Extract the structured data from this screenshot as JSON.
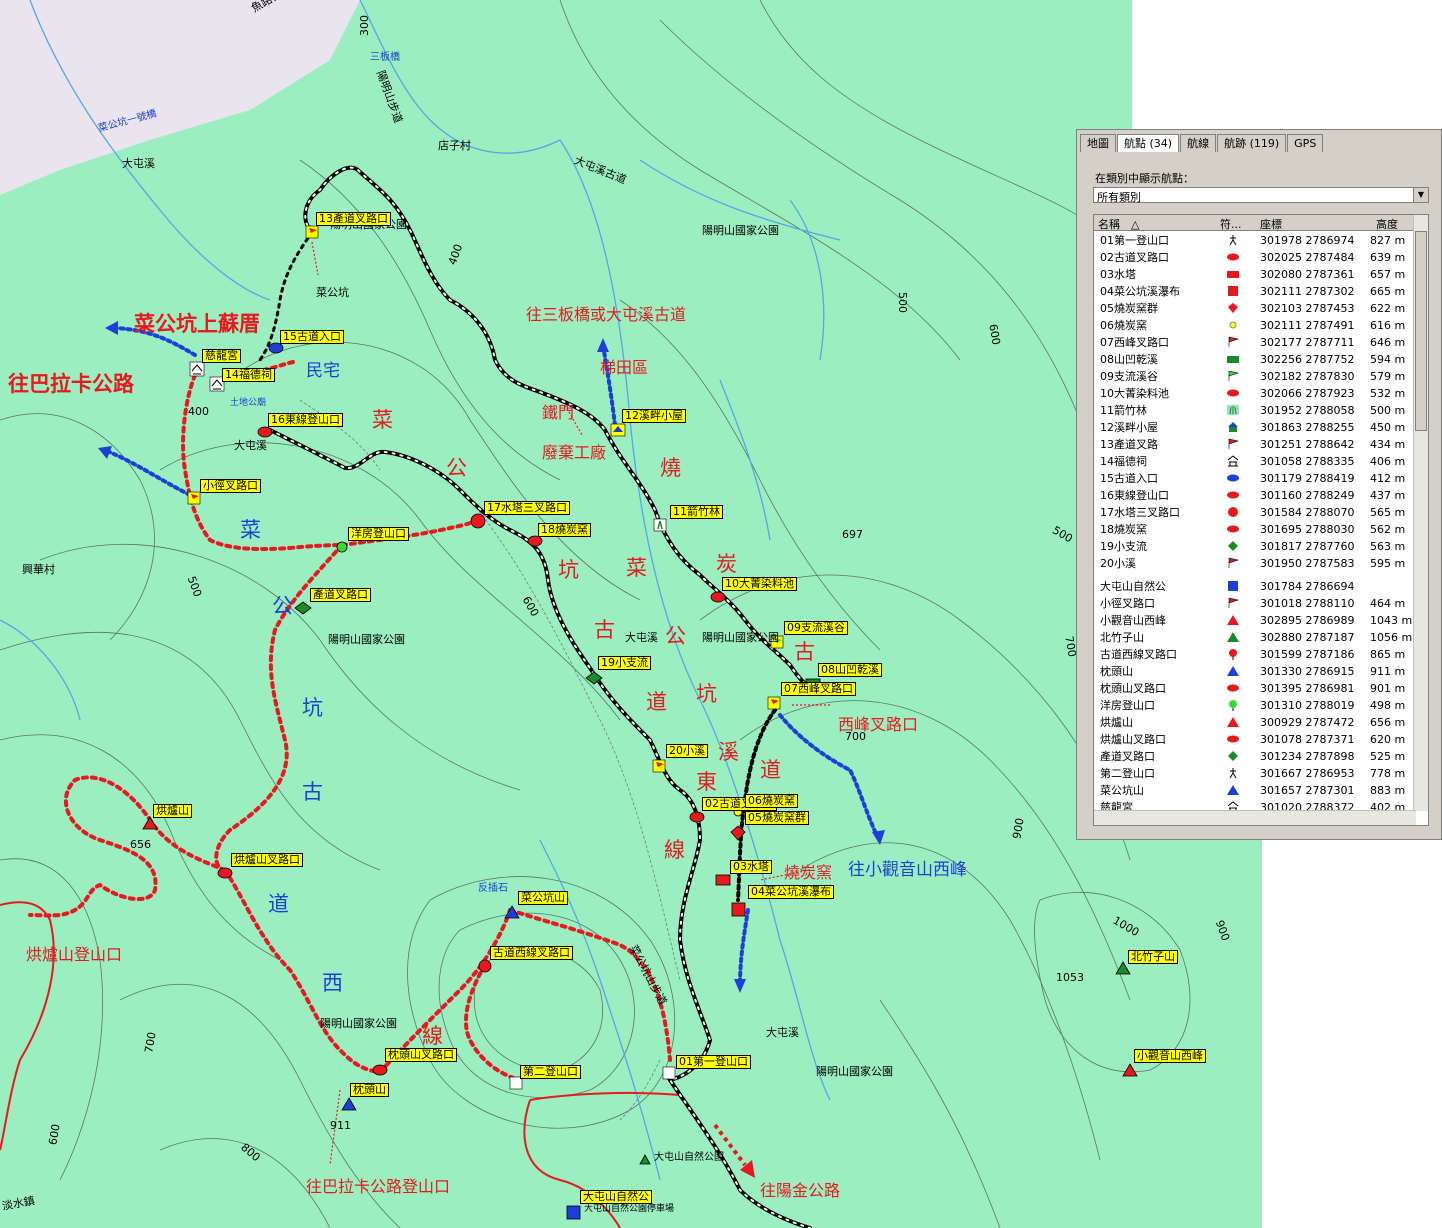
{
  "map": {
    "roads": [
      "魚路古道",
      "陽明山步道",
      "大屯溪古道",
      "菜公坑山步道",
      "菜公坑一號橋",
      "三板橋"
    ],
    "places": [
      "店子村",
      "大屯溪",
      "大屯溪",
      "大屯溪",
      "菜公坑",
      "土地公廟",
      "興華村",
      "陽明山國家公園",
      "陽明山國家公園",
      "陽明山國家公園",
      "陽明山國家公園",
      "陽明山國家公園",
      "陽明山國家公園",
      "反插石",
      "大屯山自然公園",
      "大屯山自然公園停車場",
      "淡水鎮"
    ],
    "contours": [
      "300",
      "400",
      "400",
      "500",
      "500",
      "500",
      "600",
      "600",
      "600",
      "700",
      "700",
      "700",
      "800",
      "900",
      "900",
      "1000",
      "697",
      "656",
      "911",
      "1053"
    ],
    "waypoints": [
      "13產道叉路口",
      "15古道入口",
      "慈龍宮",
      "14福德祠",
      "16東線登山口",
      "小徑叉路口",
      "洋房登山口",
      "產道叉路口",
      "17水塔三叉路口",
      "18燒炭窯",
      "12溪畔小屋",
      "11箭竹林",
      "10大菁染料池",
      "09支流溪谷",
      "08山凹乾溪",
      "07西峰叉路口",
      "19小支流",
      "20小溪",
      "02古道叉路口",
      "06燒炭窯",
      "05燒炭窯群",
      "03水塔",
      "04菜公坑溪瀑布",
      "烘爐山",
      "烘爐山叉路口",
      "菜公坑山",
      "古道西線叉路口",
      "枕頭山叉路口",
      "枕頭山",
      "第二登山口",
      "01第一登山口",
      "北竹子山",
      "小觀音山西峰",
      "大屯山自然公"
    ],
    "notes": {
      "caigong_sufu": "菜公坑上蘇厝",
      "to_balaka": "往巴拉卡公路",
      "residence": "民宅",
      "to_sanban": "往三板橋或大屯溪古道",
      "terrace": "梯田區",
      "iron_door": "鐵門",
      "factory": "廢棄工廠",
      "west_peak_fork": "西峰叉路口",
      "to_xiaoguanyin": "往小觀音山西峰",
      "charcoal_kiln": "燒炭窯",
      "honglu_trailhead": "烘爐山登山口",
      "to_balaka_trailhead": "往巴拉卡公路登山口",
      "to_yangjin": "往陽金公路",
      "west_trail": [
        "菜",
        "公",
        "坑",
        "古",
        "道",
        "西",
        "線"
      ],
      "east_trail": [
        "東",
        "溪",
        "道",
        "線"
      ],
      "kiln_trail": [
        "菜",
        "公",
        "坑",
        "古",
        "道"
      ],
      "shao_tan": [
        "燒",
        "炭",
        "古"
      ],
      "caigong_vertical": [
        "菜",
        "公",
        "坑"
      ]
    }
  },
  "panel": {
    "tabs": [
      "地圖",
      "航點 (34)",
      "航線",
      "航跡 (119)",
      "GPS"
    ],
    "active_tab": 1,
    "category_label": "在類別中顯示航點：",
    "category_value": "所有類別",
    "columns": [
      "名稱　△",
      "符...",
      "座標",
      "高度"
    ],
    "rows": [
      {
        "name": "01第一登山口",
        "icon": "hiker-icon",
        "coord": "301978 2786974",
        "alt": "827 m"
      },
      {
        "name": "02古道叉路口",
        "icon": "red-oval-icon",
        "coord": "302025 2787484",
        "alt": "639 m"
      },
      {
        "name": "03水塔",
        "icon": "red-rect-icon",
        "coord": "302080 2787361",
        "alt": "657 m"
      },
      {
        "name": "04菜公坑溪瀑布",
        "icon": "red-square-icon",
        "coord": "302111 2787302",
        "alt": "665 m"
      },
      {
        "name": "05燒炭窯群",
        "icon": "red-diamond-icon",
        "coord": "302103 2787453",
        "alt": "622 m"
      },
      {
        "name": "06燒炭窯",
        "icon": "yellow-dot-icon",
        "coord": "302111 2787491",
        "alt": "616 m"
      },
      {
        "name": "07西峰叉路口",
        "icon": "red-flag-icon",
        "coord": "302177 2787711",
        "alt": "646 m"
      },
      {
        "name": "08山凹乾溪",
        "icon": "green-rect-icon",
        "coord": "302256 2787752",
        "alt": "594 m"
      },
      {
        "name": "09支流溪谷",
        "icon": "green-flag-icon",
        "coord": "302182 2787830",
        "alt": "579 m"
      },
      {
        "name": "10大菁染料池",
        "icon": "red-oval-icon",
        "coord": "302066 2787923",
        "alt": "532 m"
      },
      {
        "name": "11箭竹林",
        "icon": "bamboo-icon",
        "coord": "301952 2788058",
        "alt": "500 m"
      },
      {
        "name": "12溪畔小屋",
        "icon": "house-icon",
        "coord": "301863 2788255",
        "alt": "450 m"
      },
      {
        "name": "13產道叉路",
        "icon": "red-flag-icon",
        "coord": "301251 2788642",
        "alt": "434 m"
      },
      {
        "name": "14福德祠",
        "icon": "temple-icon",
        "coord": "301058 2788335",
        "alt": "406 m"
      },
      {
        "name": "15古道入口",
        "icon": "blue-oval-icon",
        "coord": "301179 2788419",
        "alt": "412 m"
      },
      {
        "name": "16東線登山口",
        "icon": "red-oval-icon",
        "coord": "301160 2788249",
        "alt": "437 m"
      },
      {
        "name": "17水塔三叉路口",
        "icon": "red-circle-icon",
        "coord": "301584 2788070",
        "alt": "565 m"
      },
      {
        "name": "18燒炭窯",
        "icon": "red-oval-icon",
        "coord": "301695 2788030",
        "alt": "562 m"
      },
      {
        "name": "19小支流",
        "icon": "green-diamond-icon",
        "coord": "301817 2787760",
        "alt": "563 m"
      },
      {
        "name": "20小溪",
        "icon": "red-flag-icon",
        "coord": "301950 2787583",
        "alt": "595 m"
      },
      {
        "name": "大屯山自然公",
        "icon": "blue-square-icon",
        "coord": "301784 2786694",
        "alt": ""
      },
      {
        "name": "小徑叉路口",
        "icon": "red-flag-icon",
        "coord": "301018 2788110",
        "alt": "464 m"
      },
      {
        "name": "小觀音山西峰",
        "icon": "red-triangle-icon",
        "coord": "302895 2786989",
        "alt": "1043 m"
      },
      {
        "name": "北竹子山",
        "icon": "green-triangle-icon",
        "coord": "302880 2787187",
        "alt": "1056 m"
      },
      {
        "name": "古道西線叉路口",
        "icon": "red-pin-icon",
        "coord": "301599 2787186",
        "alt": "865 m"
      },
      {
        "name": "枕頭山",
        "icon": "blue-triangle-icon",
        "coord": "301330 2786915",
        "alt": "911 m"
      },
      {
        "name": "枕頭山叉路口",
        "icon": "red-oval-icon",
        "coord": "301395 2786981",
        "alt": "901 m"
      },
      {
        "name": "洋房登山口",
        "icon": "green-pin-icon",
        "coord": "301310 2788019",
        "alt": "498 m"
      },
      {
        "name": "烘爐山",
        "icon": "red-triangle-icon",
        "coord": "300929 2787472",
        "alt": "656 m"
      },
      {
        "name": "烘爐山叉路口",
        "icon": "red-oval-icon",
        "coord": "301078 2787371",
        "alt": "620 m"
      },
      {
        "name": "產道叉路口",
        "icon": "green-diamond-icon",
        "coord": "301234 2787898",
        "alt": "525 m"
      },
      {
        "name": "第二登山口",
        "icon": "hiker-icon",
        "coord": "301667 2786953",
        "alt": "778 m"
      },
      {
        "name": "菜公坑山",
        "icon": "blue-triangle-icon",
        "coord": "301657 2787301",
        "alt": "883 m"
      },
      {
        "name": "慈龍宮",
        "icon": "temple-icon",
        "coord": "301020 2788372",
        "alt": "402 m"
      }
    ]
  }
}
